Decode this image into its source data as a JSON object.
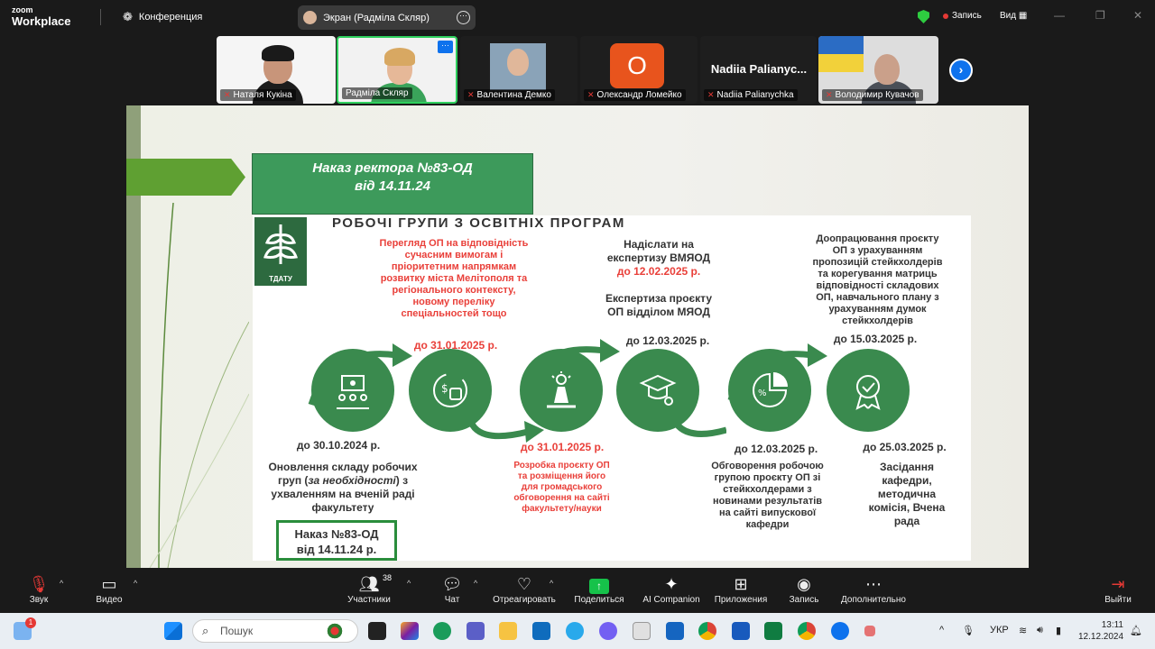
{
  "app": {
    "brand_line1": "zoom",
    "brand_line2": "Workplace",
    "meeting_label": "Конференция"
  },
  "screen_share": {
    "label": "Экран (Радміла Скляр)"
  },
  "topbar": {
    "record_label": "Запись",
    "view_label": "Вид"
  },
  "participants": [
    {
      "name": "Наталя Кукіна",
      "muted": false
    },
    {
      "name": "Радміла Скляр",
      "muted": false,
      "active_speaker": true
    },
    {
      "name": "Валентина Демко",
      "muted": true
    },
    {
      "name": "Олександр Ломейко",
      "muted": true,
      "avatar_letter": "O"
    },
    {
      "name": "Nadiia Palianychka",
      "muted": true,
      "display_name": "Nadiia Palianyc..."
    },
    {
      "name": "Володимир Кувачов",
      "muted": true
    }
  ],
  "slide": {
    "order_title_line1": "Наказ ректора №83-ОД",
    "order_title_line2": "від 14.11.24",
    "logo_label": "ТДАТУ",
    "infographic_title": "РОБОЧІ ГРУПИ З ОСВІТНІХ ПРОГРАМ",
    "top_texts": {
      "review": [
        "Перегляд ОП на відповідність",
        "сучасним вимогам і",
        "пріоритетним напрямкам",
        "розвитку міста Мелітополя та",
        "регіонального контексту,",
        "новому переліку",
        "спеціальностей тощо"
      ],
      "send_expertise": [
        "Надіслати на",
        "експертизу ВМЯОД"
      ],
      "send_deadline": "до 12.02.2025 р.",
      "expertise": [
        "Експертиза проєкту",
        "ОП відділом МЯОД"
      ],
      "refine": [
        "Доопрацювання проєкту",
        "ОП з урахуванням",
        "пропозицій стейкхолдерів",
        "та корегування матриць",
        "відповідності складових",
        "ОП, навчального плану з",
        "урахуванням думок",
        "стейкхолдерів"
      ]
    },
    "deadlines_top": [
      "до 31.01.2025 р.",
      "до 12.03.2025 р.",
      "до 15.03.2025 р."
    ],
    "deadlines_bottom": [
      "до 30.10.2024 р.",
      "до 31.01.2025 р.",
      "до 12.03.2025 р.",
      "до 25.03.2025 р."
    ],
    "bottom_texts": {
      "update_pre": "Оновлення складу робочих груп (",
      "update_italic": "за необхідності",
      "update_post": ") з ухваленням на вченій раді факультету",
      "develop": [
        "Розробка проєкту ОП",
        "та розміщення його",
        "для громадського",
        "обговорення на сайті",
        "факультету/науки"
      ],
      "discuss": [
        "Обговорення робочою",
        "групою проєкту ОП зі",
        "стейкхолдерами з",
        "новинами результатів",
        "на сайті випускової",
        "кафедри"
      ],
      "meeting": [
        "Засідання",
        "кафедри,",
        "методична",
        "комісія, Вчена",
        "рада"
      ]
    },
    "order_box_line1": "Наказ №83-ОД",
    "order_box_line2": "від 14.11.24 р."
  },
  "toolbar": {
    "audio": "Звук",
    "video": "Видео",
    "participants": "Участники",
    "participants_count": "38",
    "chat": "Чат",
    "react": "Отреагировать",
    "share": "Поделиться",
    "ai": "AI Companion",
    "apps": "Приложения",
    "record": "Запись",
    "more": "Дополнительно",
    "leave": "Выйти"
  },
  "taskbar": {
    "search_placeholder": "Пошук",
    "notif_badge": "1",
    "language": "УКР",
    "time": "13:11",
    "date": "12.12.2024"
  },
  "colors": {
    "zoom_blue": "#0e72ed",
    "share_green": "#16c24a",
    "slide_green": "#3a8a4e",
    "accent_red": "#e9403a"
  }
}
